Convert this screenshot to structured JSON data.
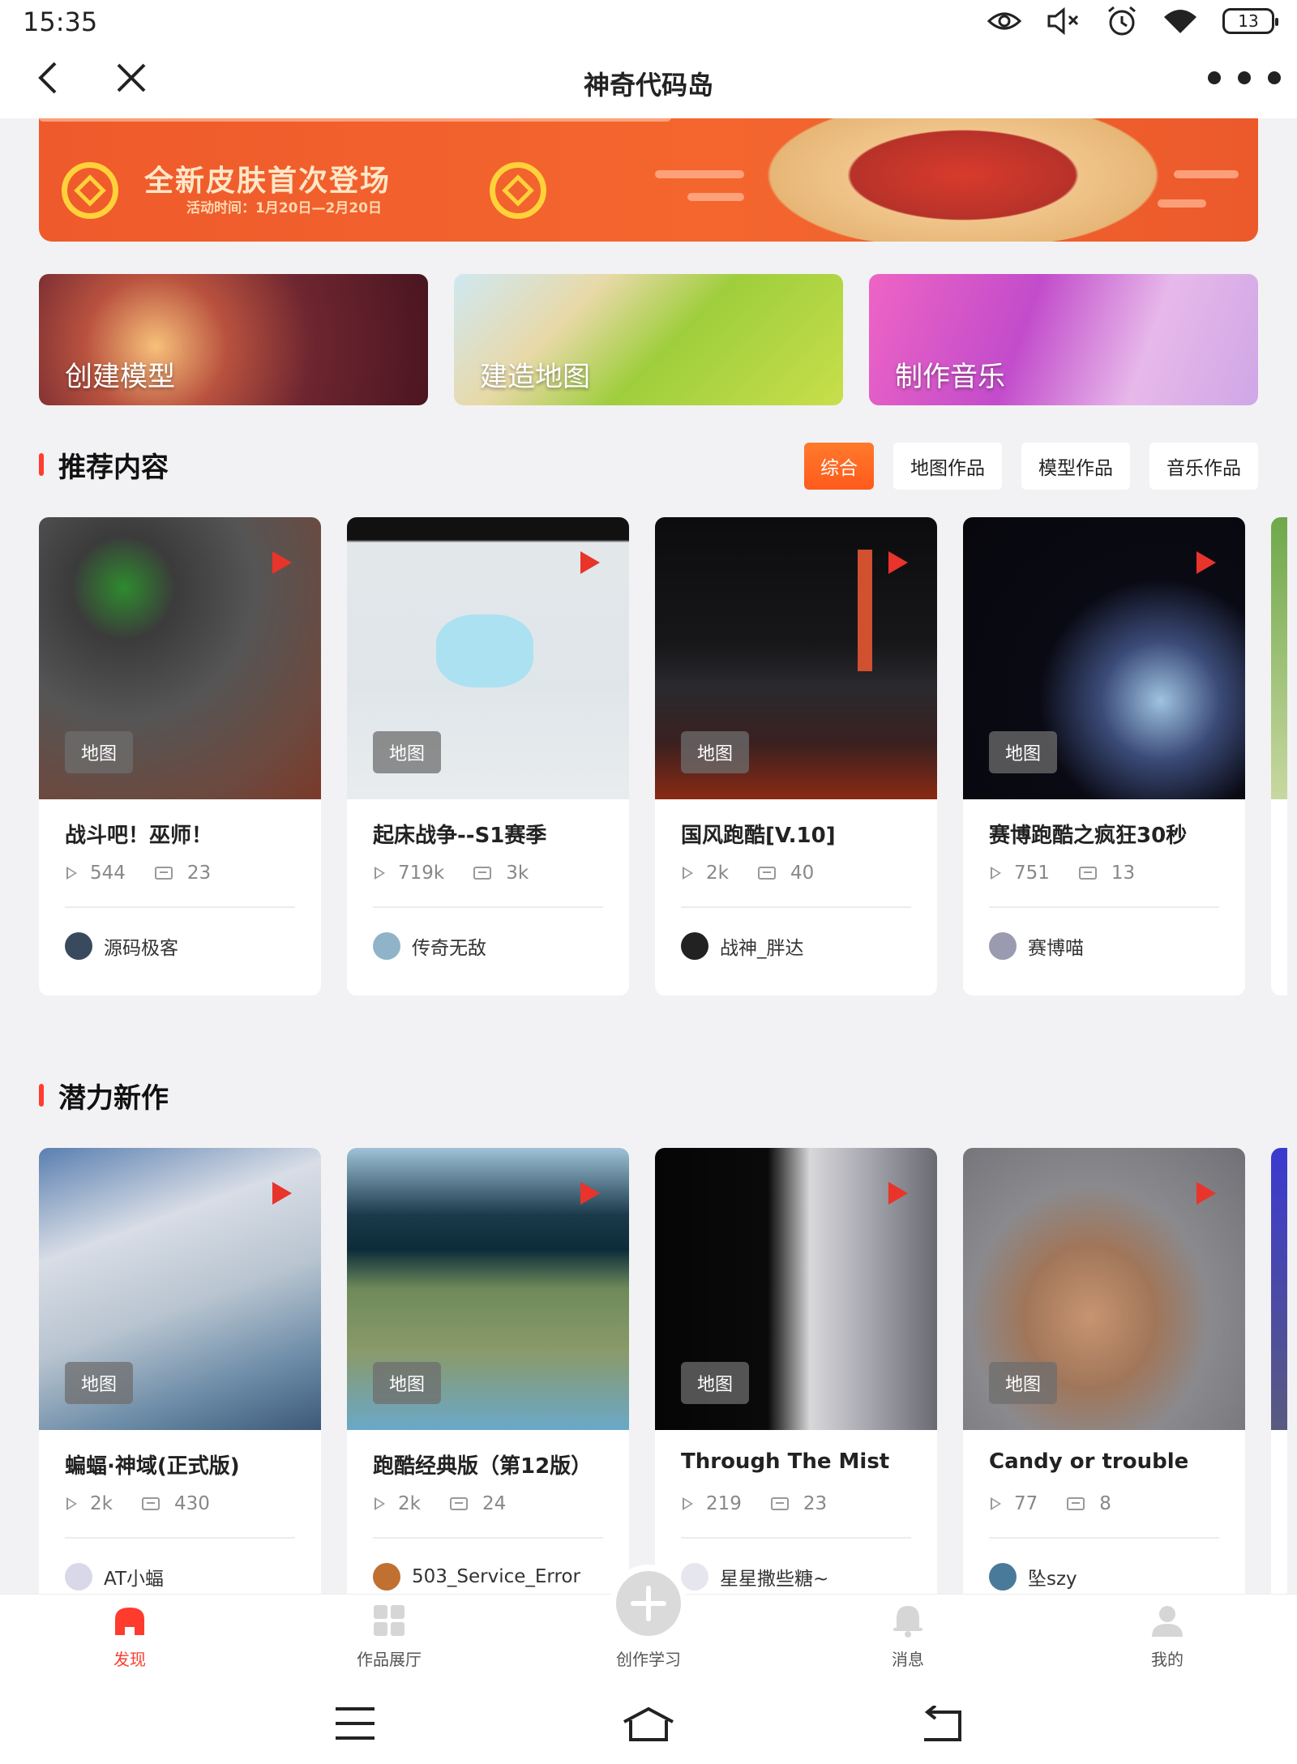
{
  "status_bar": {
    "time": "15:35",
    "battery": "13"
  },
  "title_bar": {
    "title": "神奇代码岛"
  },
  "banner": {
    "headline": "全新皮肤首次登场",
    "subline": "活动时间：1月20日—2月20日"
  },
  "quick_actions": [
    {
      "label": "创建模型"
    },
    {
      "label": "建造地图"
    },
    {
      "label": "制作音乐"
    }
  ],
  "recommended": {
    "title": "推荐内容",
    "filters": [
      "综合",
      "地图作品",
      "模型作品",
      "音乐作品"
    ],
    "active_filter": "综合",
    "cards": [
      {
        "title": "战斗吧！巫师！",
        "tag": "地图",
        "plays": "544",
        "comments": "23",
        "author": "源码极客"
      },
      {
        "title": "起床战争--S1赛季",
        "tag": "地图",
        "plays": "719k",
        "comments": "3k",
        "author": "传奇无敌"
      },
      {
        "title": "国风跑酷[V.10]",
        "tag": "地图",
        "plays": "2k",
        "comments": "40",
        "author": "战神_胖达"
      },
      {
        "title": "赛博跑酷之疯狂30秒",
        "tag": "地图",
        "plays": "751",
        "comments": "13",
        "author": "赛博喵"
      }
    ]
  },
  "new_works": {
    "title": "潜力新作",
    "cards": [
      {
        "title": "蝙蝠·神域(正式版)",
        "tag": "地图",
        "plays": "2k",
        "comments": "430",
        "author": "AT小蝠"
      },
      {
        "title": "跑酷经典版（第12版）",
        "tag": "地图",
        "plays": "2k",
        "comments": "24",
        "author": "503_Service_Error"
      },
      {
        "title": "Through The Mist",
        "tag": "地图",
        "plays": "219",
        "comments": "23",
        "author": "星星撒些糖~"
      },
      {
        "title": "Candy or trouble",
        "tag": "地图",
        "plays": "77",
        "comments": "8",
        "author": "坠szy"
      }
    ]
  },
  "bottom_nav": {
    "items": [
      {
        "label": "发现",
        "icon": "home-icon",
        "active": true
      },
      {
        "label": "作品展厅",
        "icon": "grid-icon",
        "active": false
      },
      {
        "label": "创作学习",
        "icon": "plus-icon",
        "active": false
      },
      {
        "label": "消息",
        "icon": "bell-icon",
        "active": false
      },
      {
        "label": "我的",
        "icon": "person-icon",
        "active": false
      }
    ]
  },
  "colors": {
    "accent": "#ff3b2e",
    "filter_active": "#ff6a22",
    "play": "#e8342b"
  }
}
